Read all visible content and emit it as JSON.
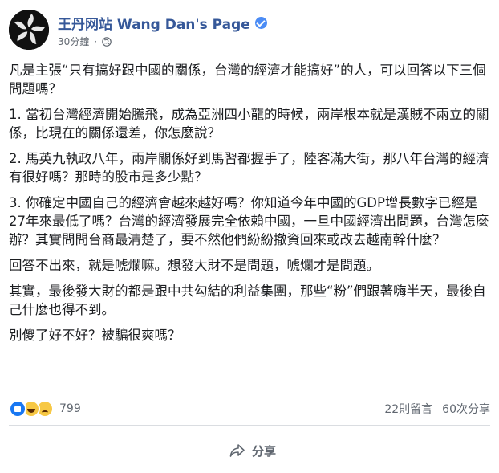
{
  "header": {
    "page_name": "王丹网站 Wang Dan's Page",
    "timestamp": "30分鐘",
    "separator": "·",
    "avatar_icon": "bauhinia-flower-icon",
    "verified_icon": "verified-badge-icon",
    "audience_icon": "globe-icon"
  },
  "post": {
    "paragraphs": [
      "凡是主張“只有搞好跟中國的關係，台灣的經濟才能搞好”的人，可以回答以下三個問題嗎？",
      "1. 當初台灣經濟開始騰飛，成為亞洲四小龍的時候，兩岸根本就是漢賊不兩立的關係，比現在的關係還差，你怎麼說？",
      "2. 馬英九執政八年，兩岸關係好到馬習都握手了，陸客滿大街，那八年台灣的經濟有很好嗎？那時的股市是多少點？",
      "3. 你確定中國自己的經濟會越來越好嗎？你知道今年中國的GDP增長數字已經是27年來最低了嗎？台灣的經濟發展完全依賴中國，一旦中國經濟出問題，台灣怎麼辦？其實問問台商最清楚了，要不然他們紛紛撤資回來或改去越南幹什麼？",
      "回答不出來，就是唬爛嘛。想發大財不是問題，唬爛才是問題。",
      "其實，最後發大財的都是跟中共勾結的利益集團，那些“粉”們跟著嗨半天，最後自己什麼也得不到。",
      "別傻了好不好？被騙很爽嗎？"
    ]
  },
  "reactions": {
    "icons": [
      "like-icon",
      "haha-icon",
      "sad-icon"
    ],
    "count": "799",
    "comments": "22則留言",
    "shares": "60次分享"
  },
  "actions": {
    "share_label": "分享",
    "share_icon": "share-arrow-icon"
  },
  "colors": {
    "page_name": "#365899",
    "secondary_text": "#606770",
    "like_blue": "#1877f2",
    "emoji_yellow": "#f7c844"
  }
}
